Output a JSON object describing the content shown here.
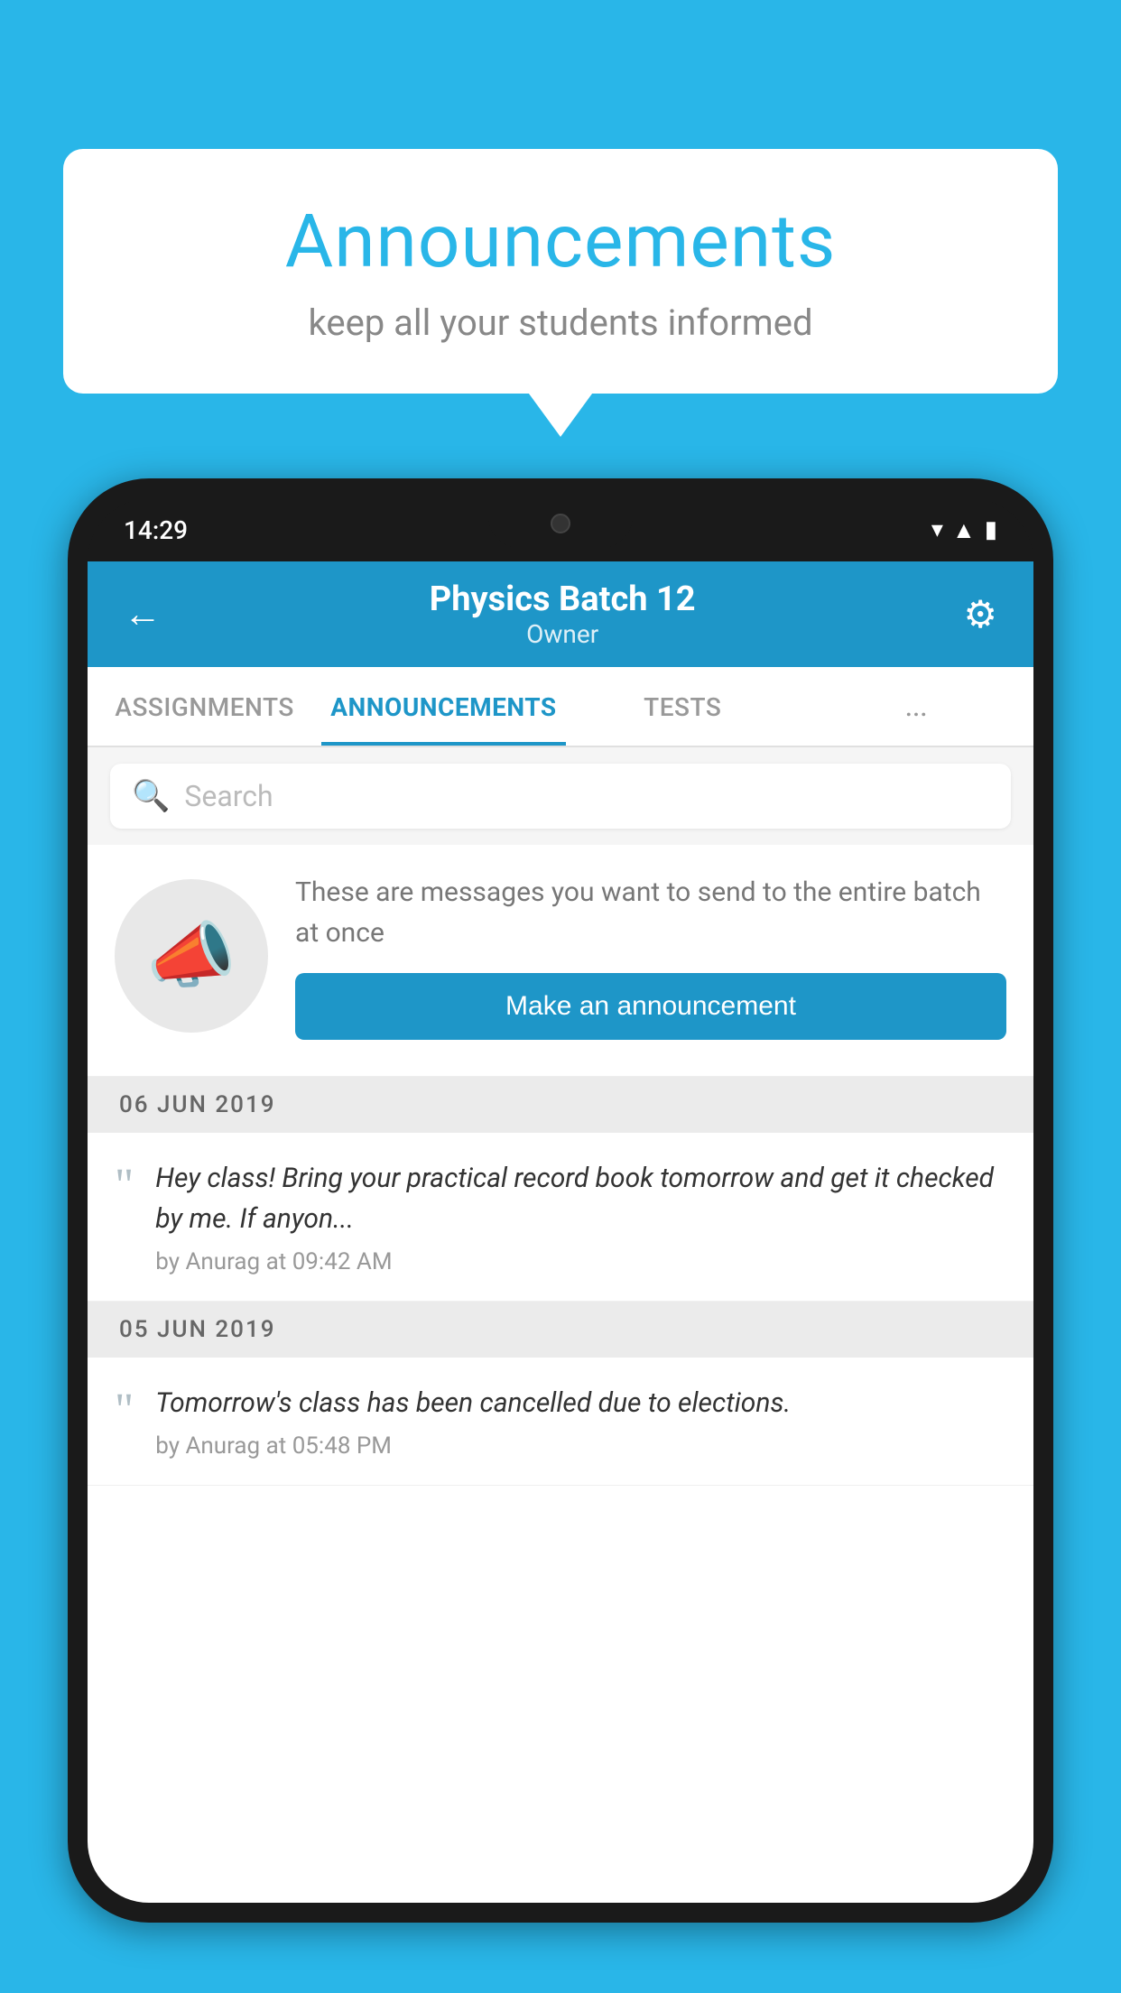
{
  "background": {
    "color": "#29b6e8"
  },
  "speech_bubble": {
    "title": "Announcements",
    "subtitle": "keep all your students informed"
  },
  "phone": {
    "status_bar": {
      "time": "14:29"
    },
    "header": {
      "title": "Physics Batch 12",
      "subtitle": "Owner",
      "back_label": "←",
      "gear_label": "⚙"
    },
    "tabs": [
      {
        "label": "ASSIGNMENTS",
        "active": false
      },
      {
        "label": "ANNOUNCEMENTS",
        "active": true
      },
      {
        "label": "TESTS",
        "active": false
      },
      {
        "label": "...",
        "active": false
      }
    ],
    "search": {
      "placeholder": "Search"
    },
    "promo": {
      "description": "These are messages you want to send to the entire batch at once",
      "button_label": "Make an announcement"
    },
    "announcement_sections": [
      {
        "date": "06  JUN  2019",
        "items": [
          {
            "text": "Hey class! Bring your practical record book tomorrow and get it checked by me. If anyon...",
            "meta": "by Anurag at 09:42 AM"
          }
        ]
      },
      {
        "date": "05  JUN  2019",
        "items": [
          {
            "text": "Tomorrow's class has been cancelled due to elections.",
            "meta": "by Anurag at 05:48 PM"
          }
        ]
      }
    ]
  }
}
